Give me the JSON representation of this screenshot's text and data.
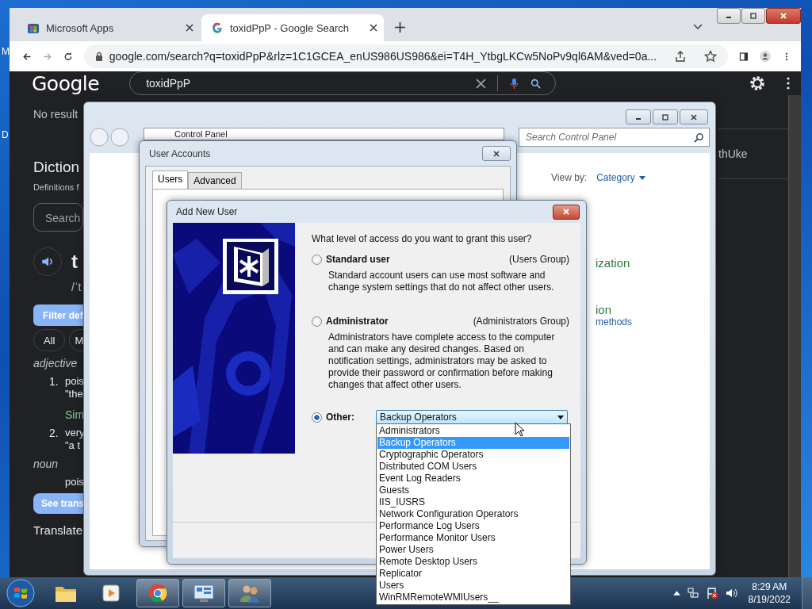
{
  "desktop": {
    "icon_labels": [
      "M",
      "D"
    ]
  },
  "browser": {
    "tabs": [
      {
        "title": "Microsoft Apps",
        "selected": false,
        "kind": "store"
      },
      {
        "title": "toxidPpP - Google Search",
        "selected": true,
        "kind": "google"
      }
    ],
    "address": "google.com/search?q=toxidPpP&rlz=1C1GCEA_enUS986US986&ei=T4H_YtbgLKCw5NoPv9ql6AM&ved=0a...",
    "logo": "Google",
    "query": "toxidPpP",
    "results": {
      "no_results": "No result",
      "dictionary_heading": "Diction",
      "definitions_note": "Definitions f",
      "search_placeholder": "Search",
      "word": "t",
      "pronunciation": "/ˈt",
      "filter_button": "Filter def",
      "chips": [
        "All",
        "M"
      ],
      "entries": [
        {
          "kind": "pos",
          "text": "adjective"
        },
        {
          "kind": "def",
          "number": "1.",
          "lines": [
            "pois",
            "\"the"
          ]
        },
        {
          "kind": "similar",
          "text": "Sim"
        },
        {
          "kind": "def",
          "number": "2.",
          "lines": [
            "very",
            "\"a t"
          ]
        },
        {
          "kind": "pos",
          "text": "noun"
        },
        {
          "kind": "def",
          "lines": [
            "pois"
          ]
        }
      ],
      "translate_button": "See trans",
      "translate_heading": "Translate"
    },
    "right_fragment": "thUke"
  },
  "control_panel": {
    "address": "Control Panel",
    "search_placeholder": "Search Control Panel",
    "view_by_label": "View by:",
    "view_by_value": "Category",
    "fragments": [
      {
        "kind": "heading",
        "text": "ization"
      },
      {
        "kind": "heading",
        "text": "ion"
      },
      {
        "kind": "link",
        "text": "methods"
      }
    ]
  },
  "user_accounts": {
    "title": "User Accounts",
    "tabs": [
      {
        "label": "Users",
        "selected": true
      },
      {
        "label": "Advanced",
        "selected": false
      }
    ]
  },
  "add_user": {
    "title": "Add New User",
    "question": "What level of access do you want to grant this user?",
    "options": [
      {
        "kind": "group",
        "label": "Standard user",
        "group": "(Users Group)",
        "description": "Standard account users can use most software and change system settings that do not affect other users.",
        "selected": false
      },
      {
        "kind": "group",
        "label": "Administrator",
        "group": "(Administrators Group)",
        "description": "Administrators have complete access to the computer and can make any desired changes. Based on notification settings, administrators may be asked to provide their password or confirmation before making changes that affect other users.",
        "selected": false
      },
      {
        "kind": "other",
        "label": "Other:",
        "value": "Backup Operators",
        "selected": true
      }
    ],
    "dropdown_items": [
      {
        "label": "Administrators",
        "selected": false
      },
      {
        "label": "Backup Operators",
        "selected": true
      },
      {
        "label": "Cryptographic Operators",
        "selected": false
      },
      {
        "label": "Distributed COM Users",
        "selected": false
      },
      {
        "label": "Event Log Readers",
        "selected": false
      },
      {
        "label": "Guests",
        "selected": false
      },
      {
        "label": "IIS_IUSRS",
        "selected": false
      },
      {
        "label": "Network Configuration Operators",
        "selected": false
      },
      {
        "label": "Performance Log Users",
        "selected": false
      },
      {
        "label": "Performance Monitor Users",
        "selected": false
      },
      {
        "label": "Power Users",
        "selected": false
      },
      {
        "label": "Remote Desktop Users",
        "selected": false
      },
      {
        "label": "Replicator",
        "selected": false
      },
      {
        "label": "Users",
        "selected": false
      },
      {
        "label": "WinRMRemoteWMIUsers__",
        "selected": false
      }
    ]
  },
  "taskbar": {
    "buttons": [
      {
        "kind": "folder",
        "active": false
      },
      {
        "kind": "media",
        "active": false
      },
      {
        "kind": "chrome",
        "active": true
      },
      {
        "kind": "panel",
        "active": true
      },
      {
        "kind": "users",
        "active": true
      }
    ],
    "time": "8:29 AM",
    "date": "8/19/2022"
  }
}
